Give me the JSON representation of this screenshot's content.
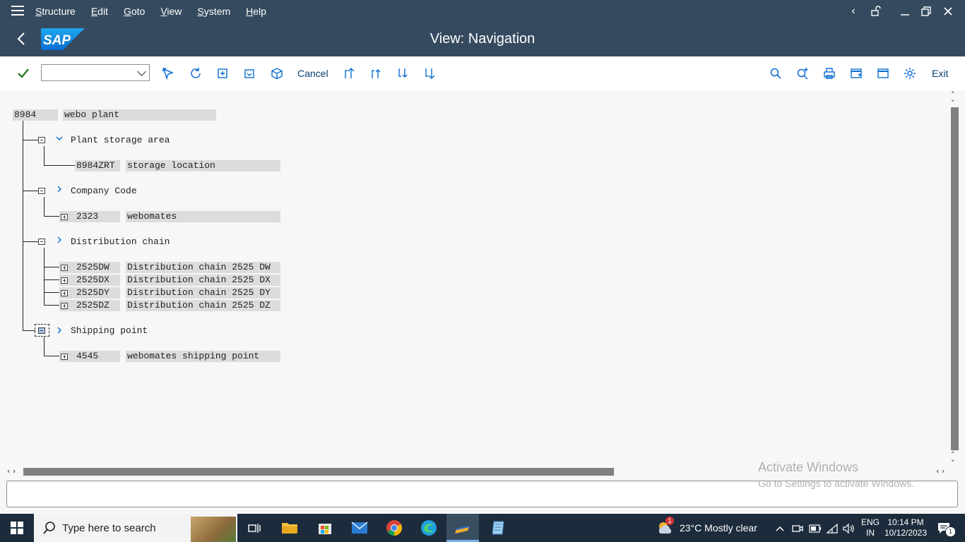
{
  "menu": {
    "items": [
      "Structure",
      "Edit",
      "Goto",
      "View",
      "System",
      "Help"
    ]
  },
  "title": "View: Navigation",
  "logo_text": "SAP",
  "toolbar": {
    "cancel_label": "Cancel",
    "exit_label": "Exit",
    "command_field_value": ""
  },
  "tree": {
    "root": {
      "id": "8984",
      "name": "webo plant"
    },
    "groups": [
      {
        "label": "Plant storage area",
        "expanded": true,
        "items": [
          {
            "id": "8984ZRT",
            "name": "storage location"
          }
        ]
      },
      {
        "label": "Company Code",
        "expanded": false,
        "items": [
          {
            "id": "2323",
            "name": "webomates"
          }
        ]
      },
      {
        "label": "Distribution chain",
        "expanded": false,
        "items": [
          {
            "id": "2525DW",
            "name": "Distribution chain 2525 DW"
          },
          {
            "id": "2525DX",
            "name": "Distribution chain 2525 DX"
          },
          {
            "id": "2525DY",
            "name": "Distribution chain 2525 DY"
          },
          {
            "id": "2525DZ",
            "name": "Distribution chain 2525 DZ"
          }
        ]
      },
      {
        "label": "Shipping point",
        "expanded": false,
        "items": [
          {
            "id": "4545",
            "name": "webomates shipping point"
          }
        ]
      }
    ]
  },
  "watermark": {
    "line1": "Activate Windows",
    "line2": "Go to Settings to activate Windows."
  },
  "taskbar": {
    "search_placeholder": "Type here to search",
    "weather": "23°C  Mostly clear",
    "weather_badge": "1",
    "lang1": "ENG",
    "lang2": "IN",
    "time": "10:14 PM",
    "date": "10/12/2023",
    "notif_count": "1"
  },
  "colors": {
    "shell": "#354a5f",
    "accent": "#0a6ed1",
    "taskbar": "#1c2c3c"
  }
}
